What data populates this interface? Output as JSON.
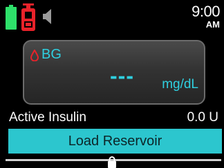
{
  "status_bar": {
    "battery_icon": "battery-full-icon",
    "reservoir_icon": "reservoir-empty-icon",
    "sound_icon": "speaker-icon",
    "time": "9:00",
    "ampm": "AM"
  },
  "bg_panel": {
    "icon": "blood-drop-icon",
    "label": "BG",
    "value": "---",
    "unit": "mg/dL"
  },
  "active_insulin": {
    "label": "Active Insulin",
    "value": "0.0 U"
  },
  "load_reservoir_button": {
    "label": "Load Reservoir"
  },
  "lock_icon": "lock-icon",
  "colors": {
    "accent_cyan": "#2fd0e0",
    "button_cyan": "#2cc6ce",
    "alert_red": "#e8222a",
    "battery_green": "#2ee06a"
  }
}
